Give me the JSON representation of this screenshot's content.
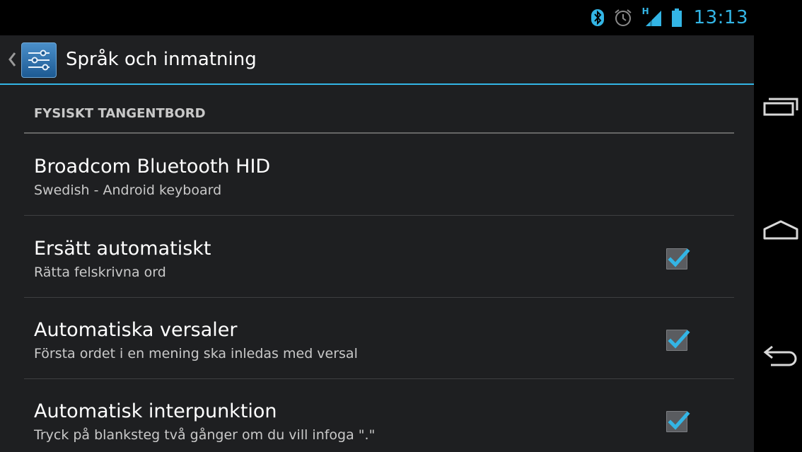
{
  "status_bar": {
    "clock": "13:13",
    "icons": [
      "bluetooth-icon",
      "alarm-icon",
      "signal-hspa-icon",
      "battery-icon"
    ],
    "signal_label": "H",
    "accent_color": "#33b5e5"
  },
  "action_bar": {
    "title": "Språk och inmatning",
    "icon": "settings-sliders-icon",
    "up_icon": "chevron-left-icon"
  },
  "category": {
    "title": "FYSISKT TANGENTBORD"
  },
  "preferences": [
    {
      "title": "Broadcom Bluetooth HID",
      "summary": "Swedish - Android keyboard",
      "checkbox": null
    },
    {
      "title": "Ersätt automatiskt",
      "summary": "Rätta felskrivna ord",
      "checkbox": true
    },
    {
      "title": "Automatiska versaler",
      "summary": "Första ordet i en mening ska inledas med versal",
      "checkbox": true
    },
    {
      "title": "Automatisk interpunktion",
      "summary": "Tryck på blanksteg två gånger om du vill infoga \".\"",
      "checkbox": true
    }
  ],
  "nav_bar": {
    "buttons": [
      "recent-apps-icon",
      "home-icon",
      "back-icon"
    ]
  }
}
